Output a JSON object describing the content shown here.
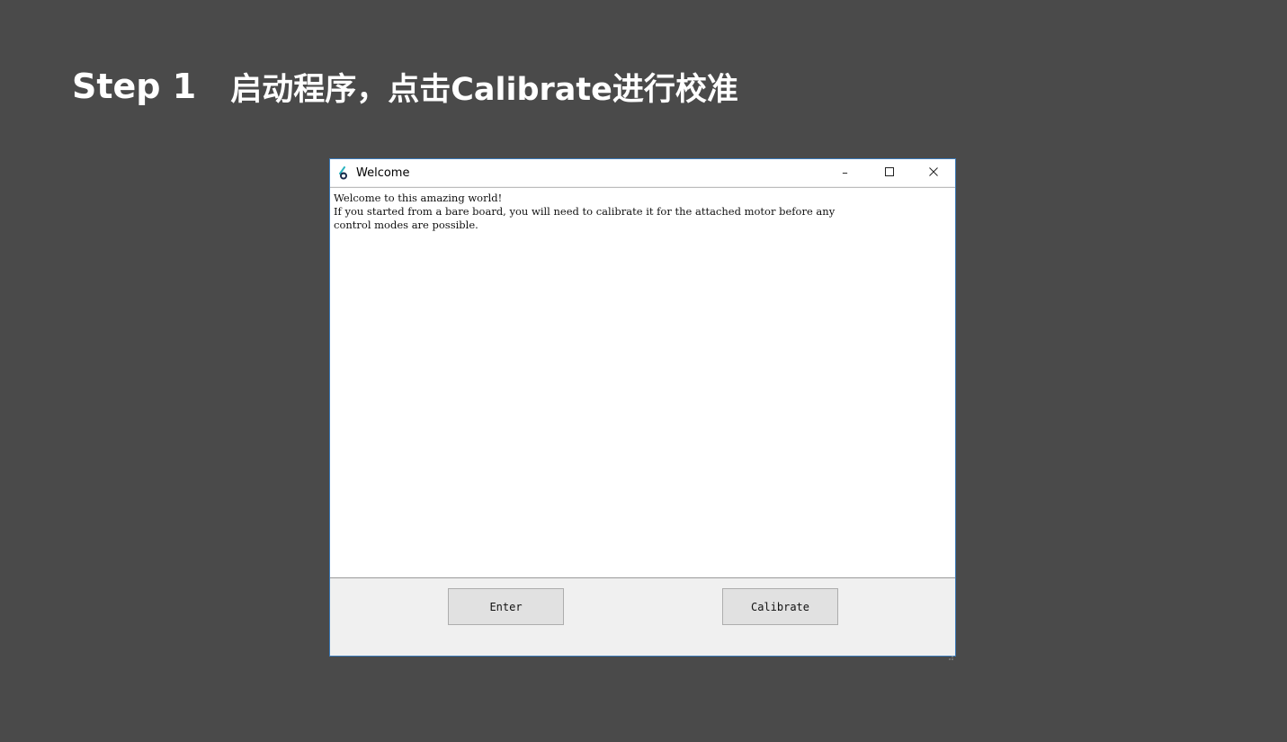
{
  "slide": {
    "step": "Step 1",
    "description": "启动程序，点击Calibrate进行校准"
  },
  "window": {
    "title": "Welcome",
    "icon": "app-logo-icon",
    "controls": {
      "minimize": "–",
      "maximize": "☐",
      "close": "✕"
    }
  },
  "console": {
    "lines": [
      "Welcome to this amazing world!",
      "If you started from a bare board, you will need to calibrate it for the attached motor before any",
      "control modes are possible."
    ]
  },
  "buttons": {
    "enter": "Enter",
    "calibrate": "Calibrate"
  },
  "colors": {
    "background": "#4a4a4a",
    "window_border": "#3b7ab8",
    "icon_accent": "#2bb3c0"
  }
}
